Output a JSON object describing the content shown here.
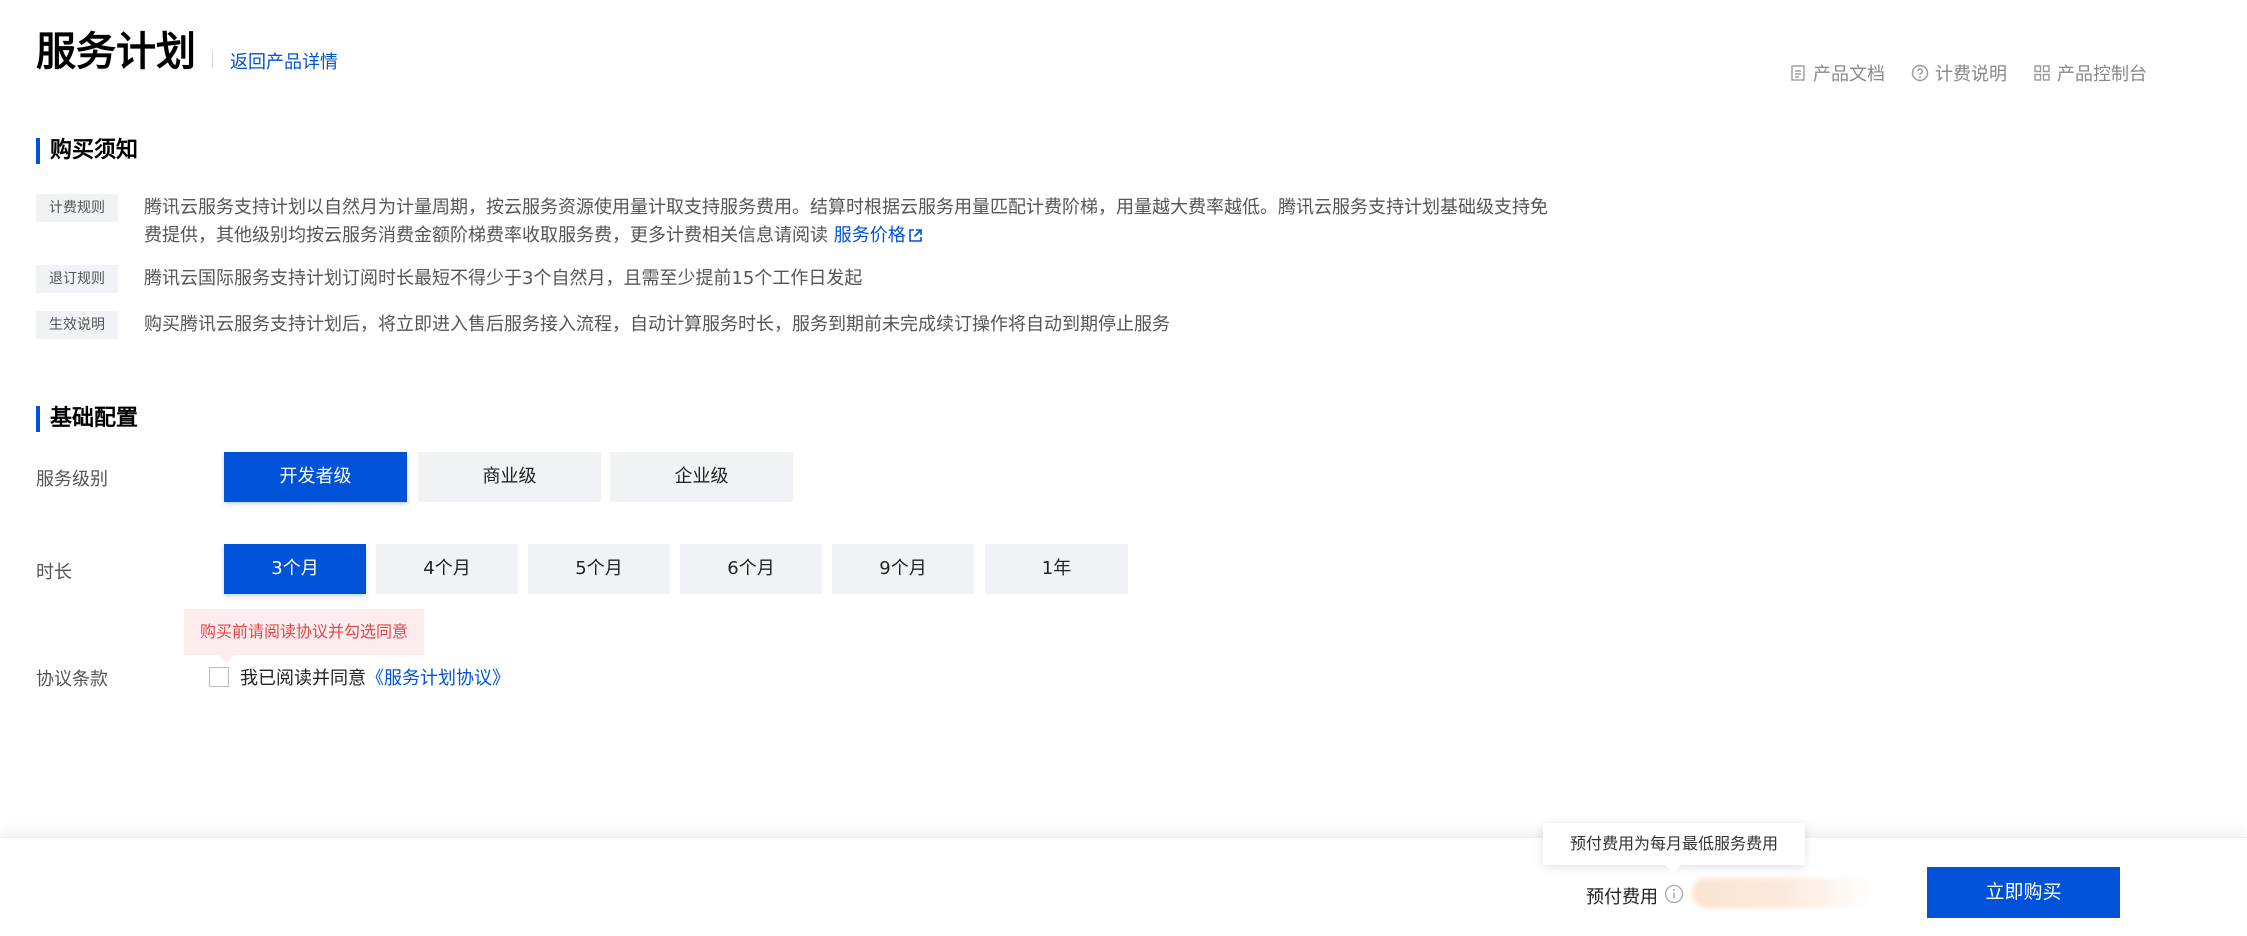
{
  "header": {
    "title": "服务计划",
    "back_link": "返回产品详情",
    "links": [
      {
        "label": "产品文档",
        "icon": "doc-icon"
      },
      {
        "label": "计费说明",
        "icon": "help-icon"
      },
      {
        "label": "产品控制台",
        "icon": "grid-icon"
      }
    ]
  },
  "notice": {
    "title": "购买须知",
    "rows": [
      {
        "tag": "计费规则",
        "text": "腾讯云服务支持计划以自然月为计量周期，按云服务资源使用量计取支持服务费用。结算时根据云服务用量匹配计费阶梯，用量越大费率越低。腾讯云服务支持计划基础级支持免费提供，其他级别均按云服务消费金额阶梯费率收取服务费，更多计费相关信息请阅读",
        "link": "服务价格"
      },
      {
        "tag": "退订规则",
        "text": "腾讯云国际服务支持计划订阅时长最短不得少于3个自然月，且需至少提前15个工作日发起"
      },
      {
        "tag": "生效说明",
        "text": "购买腾讯云服务支持计划后，将立即进入售后服务接入流程，自动计算服务时长，服务到期前未完成续订操作将自动到期停止服务"
      }
    ]
  },
  "config": {
    "title": "基础配置",
    "level_label": "服务级别",
    "levels": [
      "开发者级",
      "商业级",
      "企业级"
    ],
    "selected_level": "开发者级",
    "duration_label": "时长",
    "durations": [
      "3个月",
      "4个月",
      "5个月",
      "6个月",
      "9个月",
      "1年"
    ],
    "selected_duration": "3个月",
    "agreement_label": "协议条款",
    "agreement_warning": "购买前请阅读协议并勾选同意",
    "agreement_text": "我已阅读并同意",
    "agreement_link": "《服务计划协议》",
    "agreement_checked": false
  },
  "footer": {
    "fee_tooltip": "预付费用为每月最低服务费用",
    "fee_label": "预付费用",
    "buy_button": "立即购买"
  },
  "colors": {
    "accent": "#0052d9",
    "warning": "#e54545",
    "warning_bg": "#fdecee",
    "option_bg": "#f0f2f5"
  }
}
